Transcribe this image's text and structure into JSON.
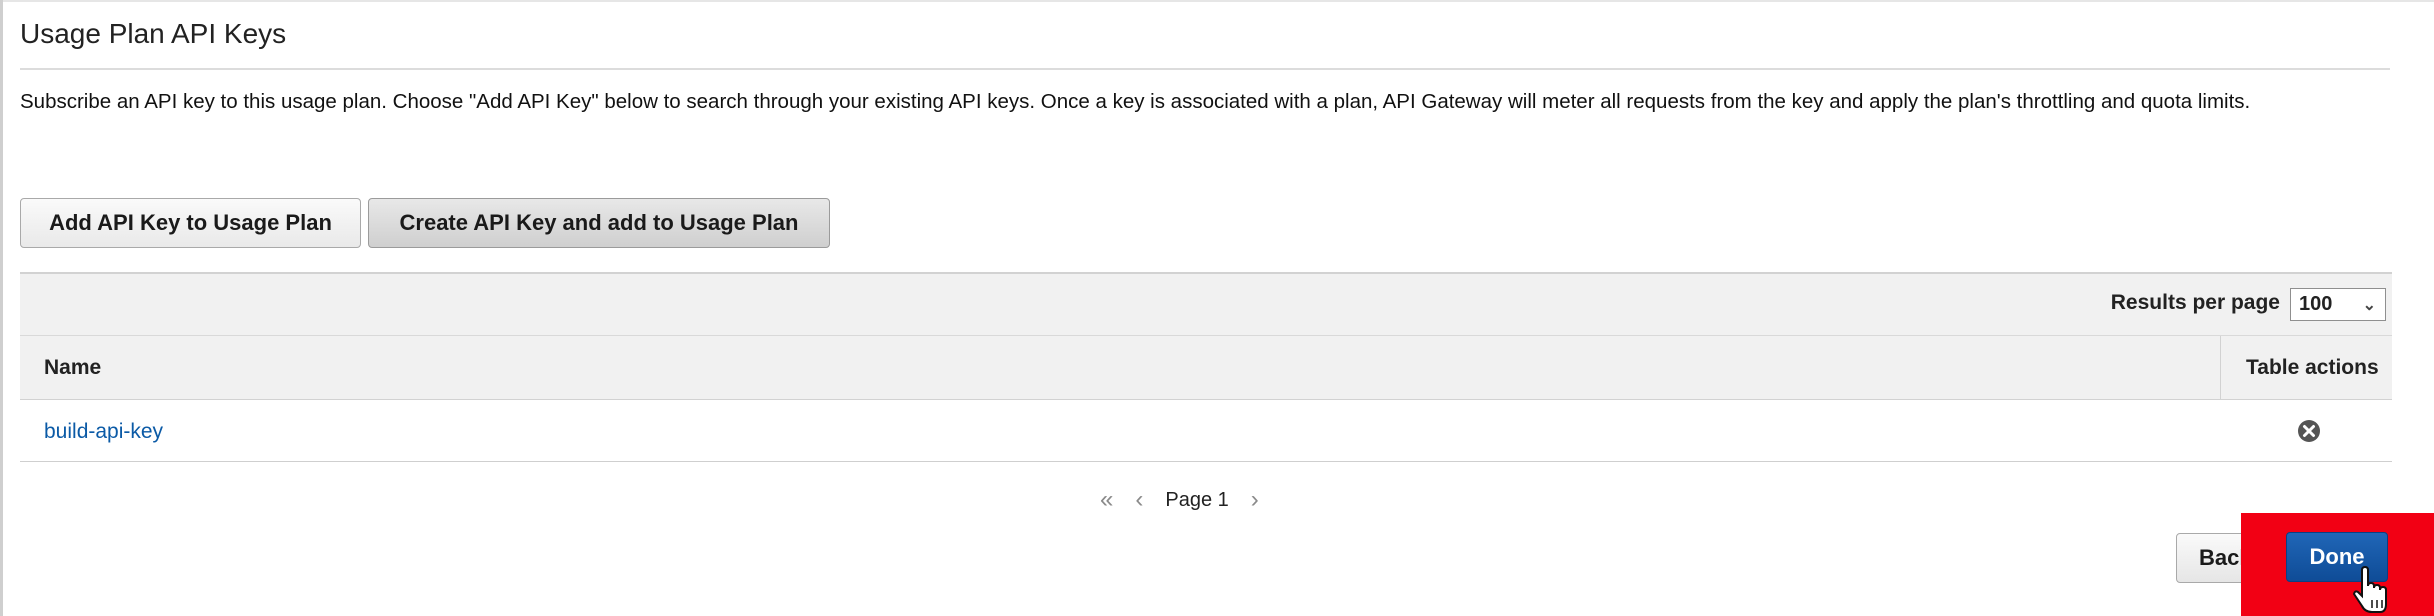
{
  "section": {
    "title": "Usage Plan API Keys",
    "description": "Subscribe an API key to this usage plan. Choose \"Add API Key\" below to search through your existing API keys. Once a key is associated with a plan, API Gateway will meter all requests from the key and apply the plan's throttling and quota limits."
  },
  "actions": {
    "add_key_label": "Add API Key to Usage Plan",
    "create_key_label": "Create API Key and add to Usage Plan"
  },
  "table": {
    "results_per_page_label": "Results per page",
    "results_per_page_value": "100",
    "columns": {
      "name": "Name",
      "actions": "Table actions"
    },
    "rows": [
      {
        "name": "build-api-key",
        "action_icon": "remove-circle-icon"
      }
    ]
  },
  "pagination": {
    "page_label": "Page 1"
  },
  "footer": {
    "back_label": "Back",
    "done_label": "Done",
    "highlight_color": "#f20014",
    "done_color": "#0f4c97"
  }
}
